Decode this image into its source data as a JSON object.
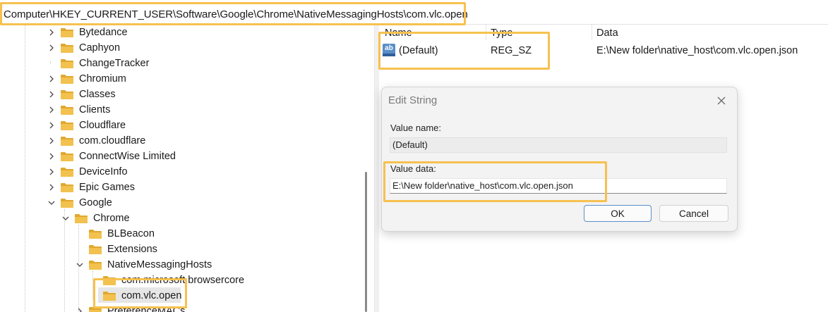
{
  "address_bar": {
    "path": "Computer\\HKEY_CURRENT_USER\\Software\\Google\\Chrome\\NativeMessagingHosts\\com.vlc.open"
  },
  "tree": {
    "items": [
      {
        "label": "Bytedance",
        "level": 0,
        "expander": "collapsed"
      },
      {
        "label": "Caphyon",
        "level": 0,
        "expander": "collapsed"
      },
      {
        "label": "ChangeTracker",
        "level": 0,
        "expander": "none"
      },
      {
        "label": "Chromium",
        "level": 0,
        "expander": "collapsed"
      },
      {
        "label": "Classes",
        "level": 0,
        "expander": "collapsed"
      },
      {
        "label": "Clients",
        "level": 0,
        "expander": "collapsed"
      },
      {
        "label": "Cloudflare",
        "level": 0,
        "expander": "collapsed"
      },
      {
        "label": "com.cloudflare",
        "level": 0,
        "expander": "collapsed"
      },
      {
        "label": "ConnectWise Limited",
        "level": 0,
        "expander": "collapsed"
      },
      {
        "label": "DeviceInfo",
        "level": 0,
        "expander": "collapsed"
      },
      {
        "label": "Epic Games",
        "level": 0,
        "expander": "collapsed"
      },
      {
        "label": "Google",
        "level": 0,
        "expander": "expanded"
      },
      {
        "label": "Chrome",
        "level": 1,
        "expander": "expanded"
      },
      {
        "label": "BLBeacon",
        "level": 2,
        "expander": "none"
      },
      {
        "label": "Extensions",
        "level": 2,
        "expander": "none"
      },
      {
        "label": "NativeMessagingHosts",
        "level": 2,
        "expander": "expanded"
      },
      {
        "label": "com.microsoft.browsercore",
        "level": 3,
        "expander": "none"
      },
      {
        "label": "com.vlc.open",
        "level": 3,
        "expander": "none",
        "selected": true
      },
      {
        "label": "PreferenceMACs",
        "level": 2,
        "expander": "collapsed"
      }
    ]
  },
  "list": {
    "columns": {
      "name": "Name",
      "type": "Type",
      "data": "Data"
    },
    "rows": [
      {
        "icon": "string-value-icon",
        "icon_text": "ab",
        "name": "(Default)",
        "type": "REG_SZ",
        "data": "E:\\New folder\\native_host\\com.vlc.open.json"
      }
    ]
  },
  "dialog": {
    "title": "Edit String",
    "value_name_label": "Value name:",
    "value_name": "(Default)",
    "value_data_label": "Value data:",
    "value_data": "E:\\New folder\\native_host\\com.vlc.open.json",
    "ok_label": "OK",
    "cancel_label": "Cancel"
  },
  "colors": {
    "highlight": "#f6c14e",
    "folder": "#f2c14e",
    "folder_dark": "#e0a82e",
    "icon_blue": "#5a8fc9",
    "ok_border": "#5a8fc9"
  }
}
